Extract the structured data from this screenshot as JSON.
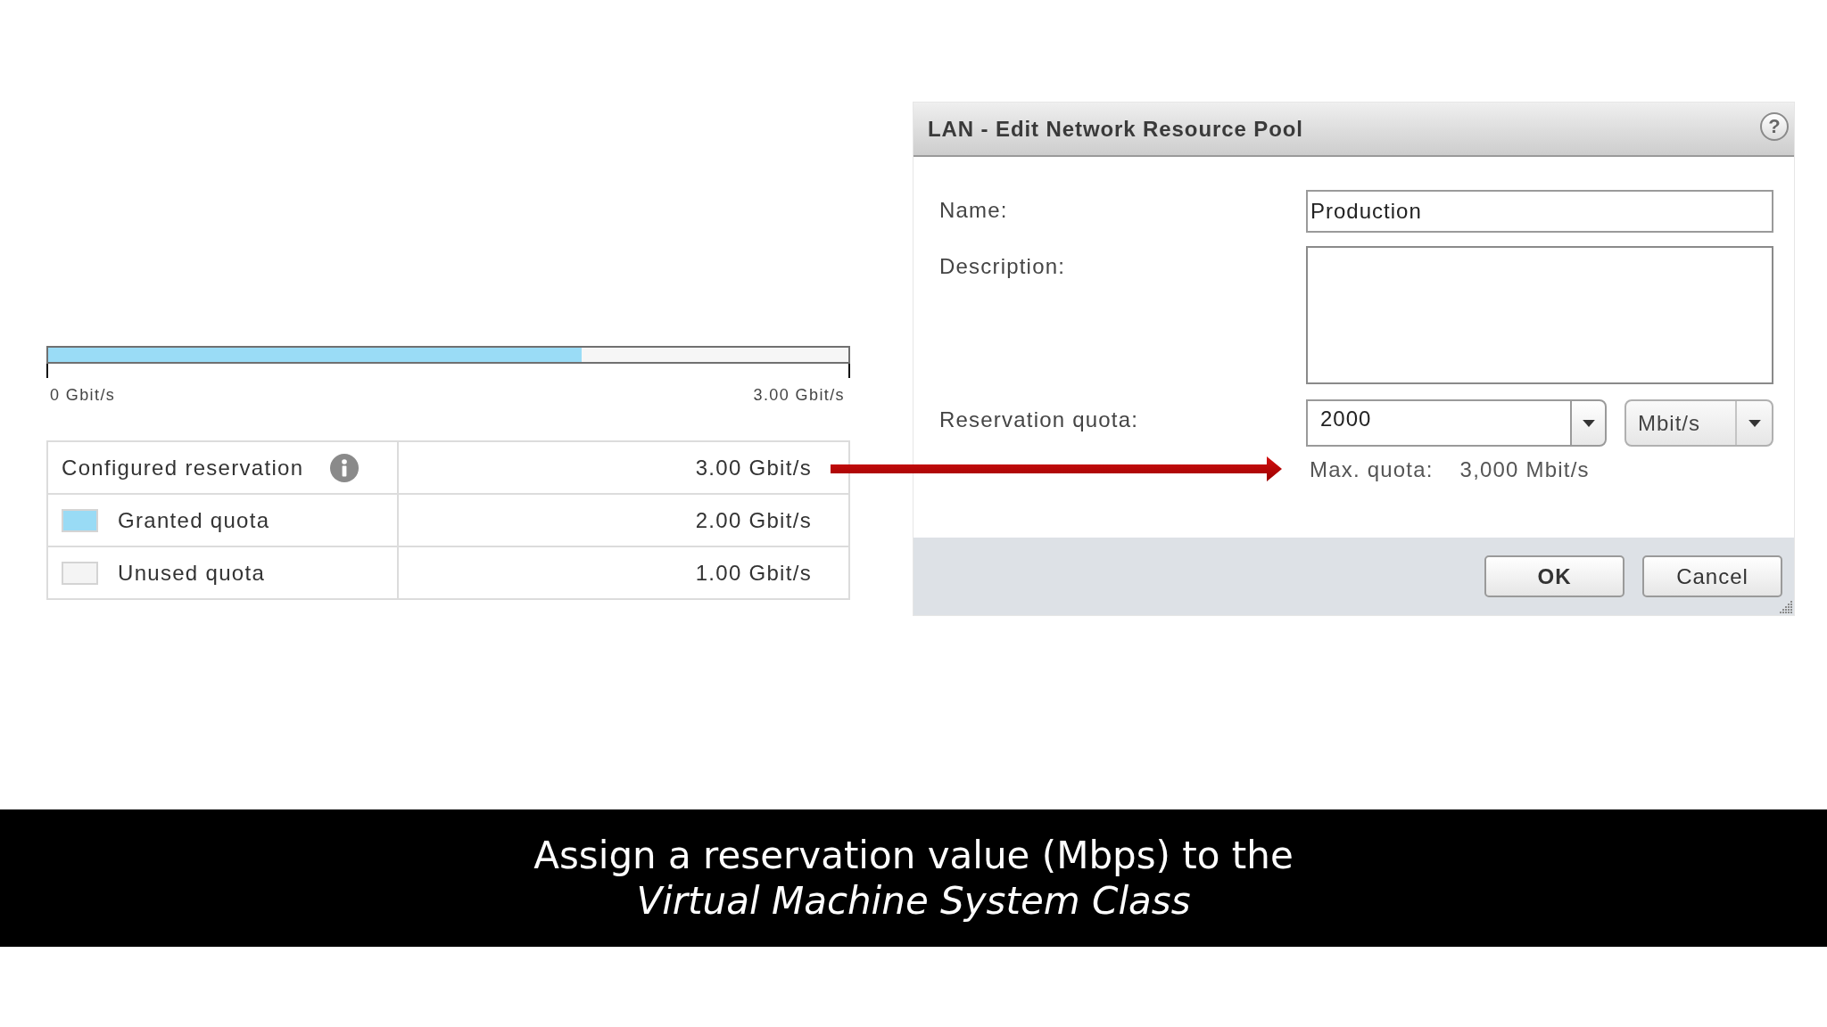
{
  "usage_bar": {
    "level": 0.667,
    "min_label": "0 Gbit/s",
    "max_label": "3.00 Gbit/s"
  },
  "reservation_table": {
    "rows": [
      {
        "kind": "info",
        "label": "Configured reservation",
        "value": "3.00 Gbit/s"
      },
      {
        "kind": "swatch",
        "label": "Granted quota",
        "value": "2.00 Gbit/s",
        "color": "#99dbf5"
      },
      {
        "kind": "swatch",
        "label": "Unused quota",
        "value": "1.00 Gbit/s",
        "color": "#f4f4f4"
      }
    ]
  },
  "dialog": {
    "title": "LAN - Edit Network Resource Pool",
    "help_button": "?",
    "fields": [
      {
        "kind": "text",
        "label": "Name:",
        "value": "Production"
      },
      {
        "kind": "textarea",
        "label": "Description:"
      },
      {
        "kind": "quota",
        "label": "Reservation quota:",
        "value": "2000",
        "unit": "Mbit/s",
        "limit_label": "Max. quota:",
        "limit_value": "3,000 Mbit/s"
      }
    ],
    "buttons": [
      {
        "label": "OK",
        "primary": true
      },
      {
        "label": "Cancel",
        "primary": false
      }
    ]
  },
  "caption": "Assign a reservation value (Mbps) to the *Virtual Machine System Class*"
}
